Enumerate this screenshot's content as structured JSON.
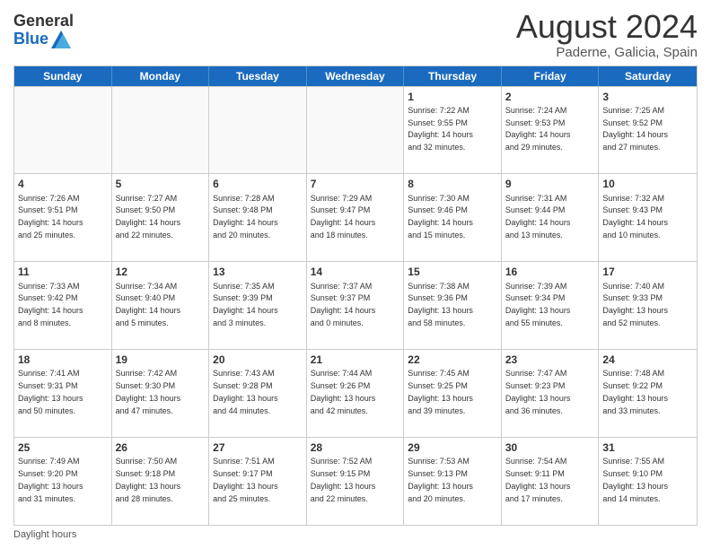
{
  "logo": {
    "general": "General",
    "blue": "Blue"
  },
  "title": "August 2024",
  "location": "Paderne, Galicia, Spain",
  "days_of_week": [
    "Sunday",
    "Monday",
    "Tuesday",
    "Wednesday",
    "Thursday",
    "Friday",
    "Saturday"
  ],
  "footer": "Daylight hours",
  "weeks": [
    [
      {
        "day": "",
        "info": ""
      },
      {
        "day": "",
        "info": ""
      },
      {
        "day": "",
        "info": ""
      },
      {
        "day": "",
        "info": ""
      },
      {
        "day": "1",
        "info": "Sunrise: 7:22 AM\nSunset: 9:55 PM\nDaylight: 14 hours\nand 32 minutes."
      },
      {
        "day": "2",
        "info": "Sunrise: 7:24 AM\nSunset: 9:53 PM\nDaylight: 14 hours\nand 29 minutes."
      },
      {
        "day": "3",
        "info": "Sunrise: 7:25 AM\nSunset: 9:52 PM\nDaylight: 14 hours\nand 27 minutes."
      }
    ],
    [
      {
        "day": "4",
        "info": "Sunrise: 7:26 AM\nSunset: 9:51 PM\nDaylight: 14 hours\nand 25 minutes."
      },
      {
        "day": "5",
        "info": "Sunrise: 7:27 AM\nSunset: 9:50 PM\nDaylight: 14 hours\nand 22 minutes."
      },
      {
        "day": "6",
        "info": "Sunrise: 7:28 AM\nSunset: 9:48 PM\nDaylight: 14 hours\nand 20 minutes."
      },
      {
        "day": "7",
        "info": "Sunrise: 7:29 AM\nSunset: 9:47 PM\nDaylight: 14 hours\nand 18 minutes."
      },
      {
        "day": "8",
        "info": "Sunrise: 7:30 AM\nSunset: 9:46 PM\nDaylight: 14 hours\nand 15 minutes."
      },
      {
        "day": "9",
        "info": "Sunrise: 7:31 AM\nSunset: 9:44 PM\nDaylight: 14 hours\nand 13 minutes."
      },
      {
        "day": "10",
        "info": "Sunrise: 7:32 AM\nSunset: 9:43 PM\nDaylight: 14 hours\nand 10 minutes."
      }
    ],
    [
      {
        "day": "11",
        "info": "Sunrise: 7:33 AM\nSunset: 9:42 PM\nDaylight: 14 hours\nand 8 minutes."
      },
      {
        "day": "12",
        "info": "Sunrise: 7:34 AM\nSunset: 9:40 PM\nDaylight: 14 hours\nand 5 minutes."
      },
      {
        "day": "13",
        "info": "Sunrise: 7:35 AM\nSunset: 9:39 PM\nDaylight: 14 hours\nand 3 minutes."
      },
      {
        "day": "14",
        "info": "Sunrise: 7:37 AM\nSunset: 9:37 PM\nDaylight: 14 hours\nand 0 minutes."
      },
      {
        "day": "15",
        "info": "Sunrise: 7:38 AM\nSunset: 9:36 PM\nDaylight: 13 hours\nand 58 minutes."
      },
      {
        "day": "16",
        "info": "Sunrise: 7:39 AM\nSunset: 9:34 PM\nDaylight: 13 hours\nand 55 minutes."
      },
      {
        "day": "17",
        "info": "Sunrise: 7:40 AM\nSunset: 9:33 PM\nDaylight: 13 hours\nand 52 minutes."
      }
    ],
    [
      {
        "day": "18",
        "info": "Sunrise: 7:41 AM\nSunset: 9:31 PM\nDaylight: 13 hours\nand 50 minutes."
      },
      {
        "day": "19",
        "info": "Sunrise: 7:42 AM\nSunset: 9:30 PM\nDaylight: 13 hours\nand 47 minutes."
      },
      {
        "day": "20",
        "info": "Sunrise: 7:43 AM\nSunset: 9:28 PM\nDaylight: 13 hours\nand 44 minutes."
      },
      {
        "day": "21",
        "info": "Sunrise: 7:44 AM\nSunset: 9:26 PM\nDaylight: 13 hours\nand 42 minutes."
      },
      {
        "day": "22",
        "info": "Sunrise: 7:45 AM\nSunset: 9:25 PM\nDaylight: 13 hours\nand 39 minutes."
      },
      {
        "day": "23",
        "info": "Sunrise: 7:47 AM\nSunset: 9:23 PM\nDaylight: 13 hours\nand 36 minutes."
      },
      {
        "day": "24",
        "info": "Sunrise: 7:48 AM\nSunset: 9:22 PM\nDaylight: 13 hours\nand 33 minutes."
      }
    ],
    [
      {
        "day": "25",
        "info": "Sunrise: 7:49 AM\nSunset: 9:20 PM\nDaylight: 13 hours\nand 31 minutes."
      },
      {
        "day": "26",
        "info": "Sunrise: 7:50 AM\nSunset: 9:18 PM\nDaylight: 13 hours\nand 28 minutes."
      },
      {
        "day": "27",
        "info": "Sunrise: 7:51 AM\nSunset: 9:17 PM\nDaylight: 13 hours\nand 25 minutes."
      },
      {
        "day": "28",
        "info": "Sunrise: 7:52 AM\nSunset: 9:15 PM\nDaylight: 13 hours\nand 22 minutes."
      },
      {
        "day": "29",
        "info": "Sunrise: 7:53 AM\nSunset: 9:13 PM\nDaylight: 13 hours\nand 20 minutes."
      },
      {
        "day": "30",
        "info": "Sunrise: 7:54 AM\nSunset: 9:11 PM\nDaylight: 13 hours\nand 17 minutes."
      },
      {
        "day": "31",
        "info": "Sunrise: 7:55 AM\nSunset: 9:10 PM\nDaylight: 13 hours\nand 14 minutes."
      }
    ]
  ]
}
